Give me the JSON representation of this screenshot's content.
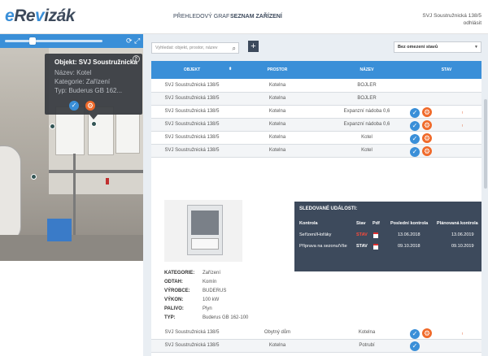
{
  "header": {
    "logo": {
      "prefix": "e",
      "mid": "Re",
      "r": "v",
      "suffix": "izák"
    },
    "nav": [
      {
        "label": "PŘEHLEDOVÝ GRAF",
        "active": false
      },
      {
        "label": "SEZNAM ZAŘÍZENÍ",
        "active": true
      }
    ],
    "user": "SVJ Soustružnická 138/5",
    "logout": "odhlásit"
  },
  "map_panel": {
    "slider_value": 0.3,
    "popup": {
      "title": "Objekt: SVJ Soustružnická",
      "lines": [
        "Název: Kotel",
        "Kategorie: Zařízení",
        "Typ: Buderus GB 162..."
      ]
    }
  },
  "toolbar": {
    "search_placeholder": "Vyhledat: objekt, prostor, název",
    "add_label": "+",
    "filter_value": "Bez omezení stavů"
  },
  "table": {
    "columns": [
      "Objekt",
      "Prostor",
      "Název",
      "Stav"
    ],
    "sort_indicator": "⬍",
    "rows": [
      {
        "objekt": "SVJ Soustružnická 138/5",
        "prostor": "Kotelna",
        "nazev": "BOJLER",
        "icons": []
      },
      {
        "objekt": "SVJ Soustružnická 138/5",
        "prostor": "Kotelna",
        "nazev": "BOJLER",
        "icons": []
      },
      {
        "objekt": "SVJ Soustružnická 138/5",
        "prostor": "Kotelna",
        "nazev": "Expanzní nádoba 0,6",
        "icons": [
          "check",
          "gear"
        ],
        "badge": "!"
      },
      {
        "objekt": "SVJ Soustružnická 138/5",
        "prostor": "Kotelna",
        "nazev": "Expanzní nádoba 0,6",
        "icons": [
          "check",
          "gear"
        ],
        "badge": "!"
      },
      {
        "objekt": "SVJ Soustružnická 138/5",
        "prostor": "Kotelna",
        "nazev": "Kotel",
        "icons": [
          "check",
          "gear"
        ],
        "badge": ""
      },
      {
        "objekt": "SVJ Soustružnická 138/5",
        "prostor": "Kotelna",
        "nazev": "Kotel",
        "icons": [
          "check",
          "gear"
        ],
        "badge": ""
      }
    ],
    "bottom_rows": [
      {
        "objekt": "SVJ Soustružnická 138/5",
        "prostor": "Obytný dům",
        "nazev": "Kotelna",
        "icons": [
          "check",
          "gear"
        ],
        "badge": "!"
      },
      {
        "objekt": "SVJ Soustružnická 138/5",
        "prostor": "Kotelna",
        "nazev": "Potrubí",
        "icons": [
          "check"
        ],
        "badge": ""
      }
    ]
  },
  "detail": {
    "events": {
      "title": "SLEDOVANÉ UDÁLOSTI:",
      "headers": [
        "Kontrola",
        "Stav",
        "Pdf",
        "Poslední kontrola",
        "Plánovaná kontrola"
      ],
      "rows": [
        {
          "kontrola": "Seřízení/Hořáky",
          "stav": "STAV",
          "stav_color": "red",
          "posledni": "13.06.2018",
          "planovana": "13.06.2019"
        },
        {
          "kontrola": "Příprava na sezonu/Vše",
          "stav": "STAV",
          "stav_color": "white",
          "posledni": "09.10.2018",
          "planovana": "09.10.2019"
        }
      ]
    },
    "properties": [
      {
        "key": "KATEGORIE:",
        "value": "Zařízení"
      },
      {
        "key": "ODTAH:",
        "value": "Komín"
      },
      {
        "key": "VÝROBCE:",
        "value": "BUDERUS"
      },
      {
        "key": "VÝKON:",
        "value": "100 kW"
      },
      {
        "key": "PALIVO:",
        "value": "Plyn"
      },
      {
        "key": "TYP:",
        "value": "Buderus GB 162-100"
      }
    ]
  },
  "colors": {
    "accent": "#3a8fd8",
    "dark": "#3d4a5c",
    "orange": "#f06a2a",
    "danger": "#ff4a3a"
  }
}
